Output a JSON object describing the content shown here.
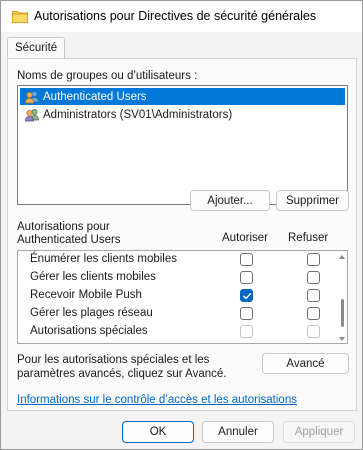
{
  "window": {
    "title": "Autorisations pour Directives de sécurité générales"
  },
  "tabs": [
    {
      "label": "Sécurité"
    }
  ],
  "groups": {
    "label": "Noms de groupes ou d’utilisateurs :",
    "items": [
      {
        "label": "Authenticated Users",
        "icon": "users-icon",
        "selected": true
      },
      {
        "label": "Administrators (SV01\\Administrators)",
        "icon": "users-icon",
        "selected": false
      }
    ],
    "add_label": "Ajouter...",
    "remove_label": "Supprimer"
  },
  "permissions": {
    "header": "Autorisations pour Authenticated Users",
    "allow_header": "Autoriser",
    "deny_header": "Refuser",
    "rows": [
      {
        "name": "Énumérer les clients mobiles",
        "allow": false,
        "deny": false,
        "disabled": false
      },
      {
        "name": "Gérer les clients mobiles",
        "allow": false,
        "deny": false,
        "disabled": false
      },
      {
        "name": "Recevoir Mobile Push",
        "allow": true,
        "deny": false,
        "disabled": false
      },
      {
        "name": "Gérer les plages réseau",
        "allow": false,
        "deny": false,
        "disabled": false
      },
      {
        "name": "Autorisations spéciales",
        "allow": false,
        "deny": false,
        "disabled": true
      }
    ]
  },
  "special": {
    "text": "Pour les autorisations spéciales et les paramètres avancés, cliquez sur Avancé.",
    "advanced_label": "Avancé"
  },
  "link": {
    "text": "Informations sur le contrôle d’accès et les autorisations"
  },
  "footer": {
    "ok_label": "OK",
    "cancel_label": "Annuler",
    "apply_label": "Appliquer"
  },
  "colors": {
    "accent": "#0067c0",
    "selection": "#0078d7",
    "link": "#0066cc"
  }
}
